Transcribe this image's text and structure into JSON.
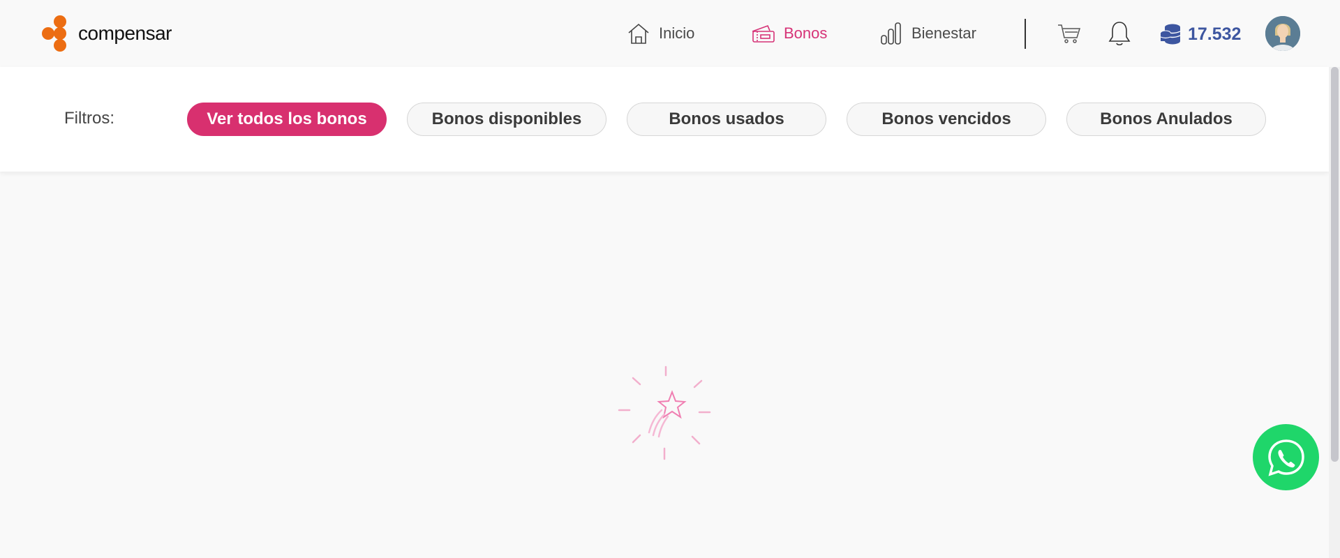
{
  "brand": {
    "name": "compensar",
    "color": "#ec6d12"
  },
  "nav": {
    "items": [
      {
        "label": "Inicio",
        "icon": "home-icon"
      },
      {
        "label": "Bonos",
        "icon": "ticket-icon",
        "active": true
      },
      {
        "label": "Bienestar",
        "icon": "bar-chart-icon"
      }
    ]
  },
  "header_actions": {
    "cart_icon": "cart-icon",
    "bell_icon": "bell-icon",
    "points_icon": "coins-icon",
    "points": "17.532"
  },
  "filters": {
    "label": "Filtros:",
    "options": [
      {
        "label": "Ver todos los bonos",
        "active": true
      },
      {
        "label": "Bonos disponibles"
      },
      {
        "label": "Bonos usados"
      },
      {
        "label": "Bonos vencidos"
      },
      {
        "label": "Bonos Anulados"
      }
    ]
  },
  "loader": {
    "icon": "shooting-star-icon"
  },
  "whatsapp": {
    "icon": "whatsapp-icon"
  },
  "colors": {
    "accent": "#d8306f",
    "points": "#3d56a0",
    "whatsapp": "#1fd66a"
  }
}
